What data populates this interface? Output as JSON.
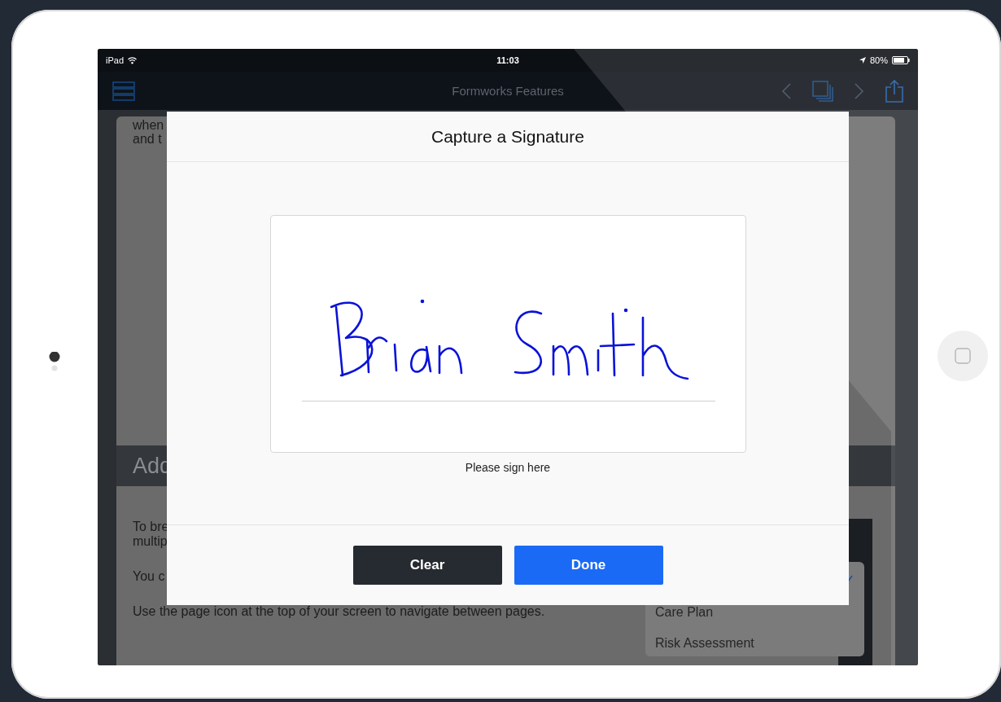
{
  "status_bar": {
    "carrier": "iPad",
    "time": "11:03",
    "battery": "80%"
  },
  "nav_bar": {
    "title": "Formworks Features"
  },
  "content": {
    "card_lines": [
      "when",
      "and t"
    ],
    "section_title": "Add",
    "paragraphs": [
      "To bre\nmultip",
      "You c",
      "Use the page icon at the top of your screen to navigate between pages."
    ]
  },
  "page_menu": {
    "items": [
      {
        "label": "Care Plan",
        "selected": false
      },
      {
        "label": "Risk Assessment",
        "selected": false
      }
    ]
  },
  "modal": {
    "title": "Capture a Signature",
    "caption": "Please sign here",
    "buttons": [
      {
        "label": "Clear",
        "kind": "secondary"
      },
      {
        "label": "Done",
        "kind": "primary"
      }
    ]
  }
}
